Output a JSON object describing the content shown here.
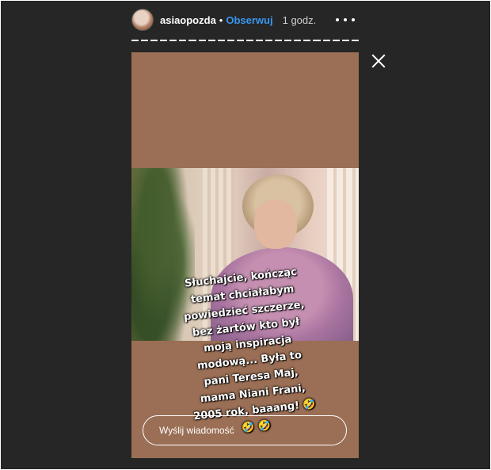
{
  "header": {
    "username": "asiaopozda",
    "separator": "•",
    "follow_label": "Obserwuj",
    "time": "1 godz.",
    "more_icon": "more-horizontal-icon"
  },
  "story": {
    "caption": "Słuchajcie, kończąc\ntemat chciałabym\npowiedzieć szczerze,\nbez żartów kto był\nmoją inspiracja\nmodową... Była to\npani Teresa Maj,\nmama Niani Frani,\n2005 rok, baaang! 🤣\n🤣 🤣",
    "reply_placeholder": "Wyślij wiadomość",
    "close_icon": "close-icon",
    "background_color": "#9a6f55"
  },
  "progress": {
    "segments": 24,
    "active_segment": 24
  }
}
